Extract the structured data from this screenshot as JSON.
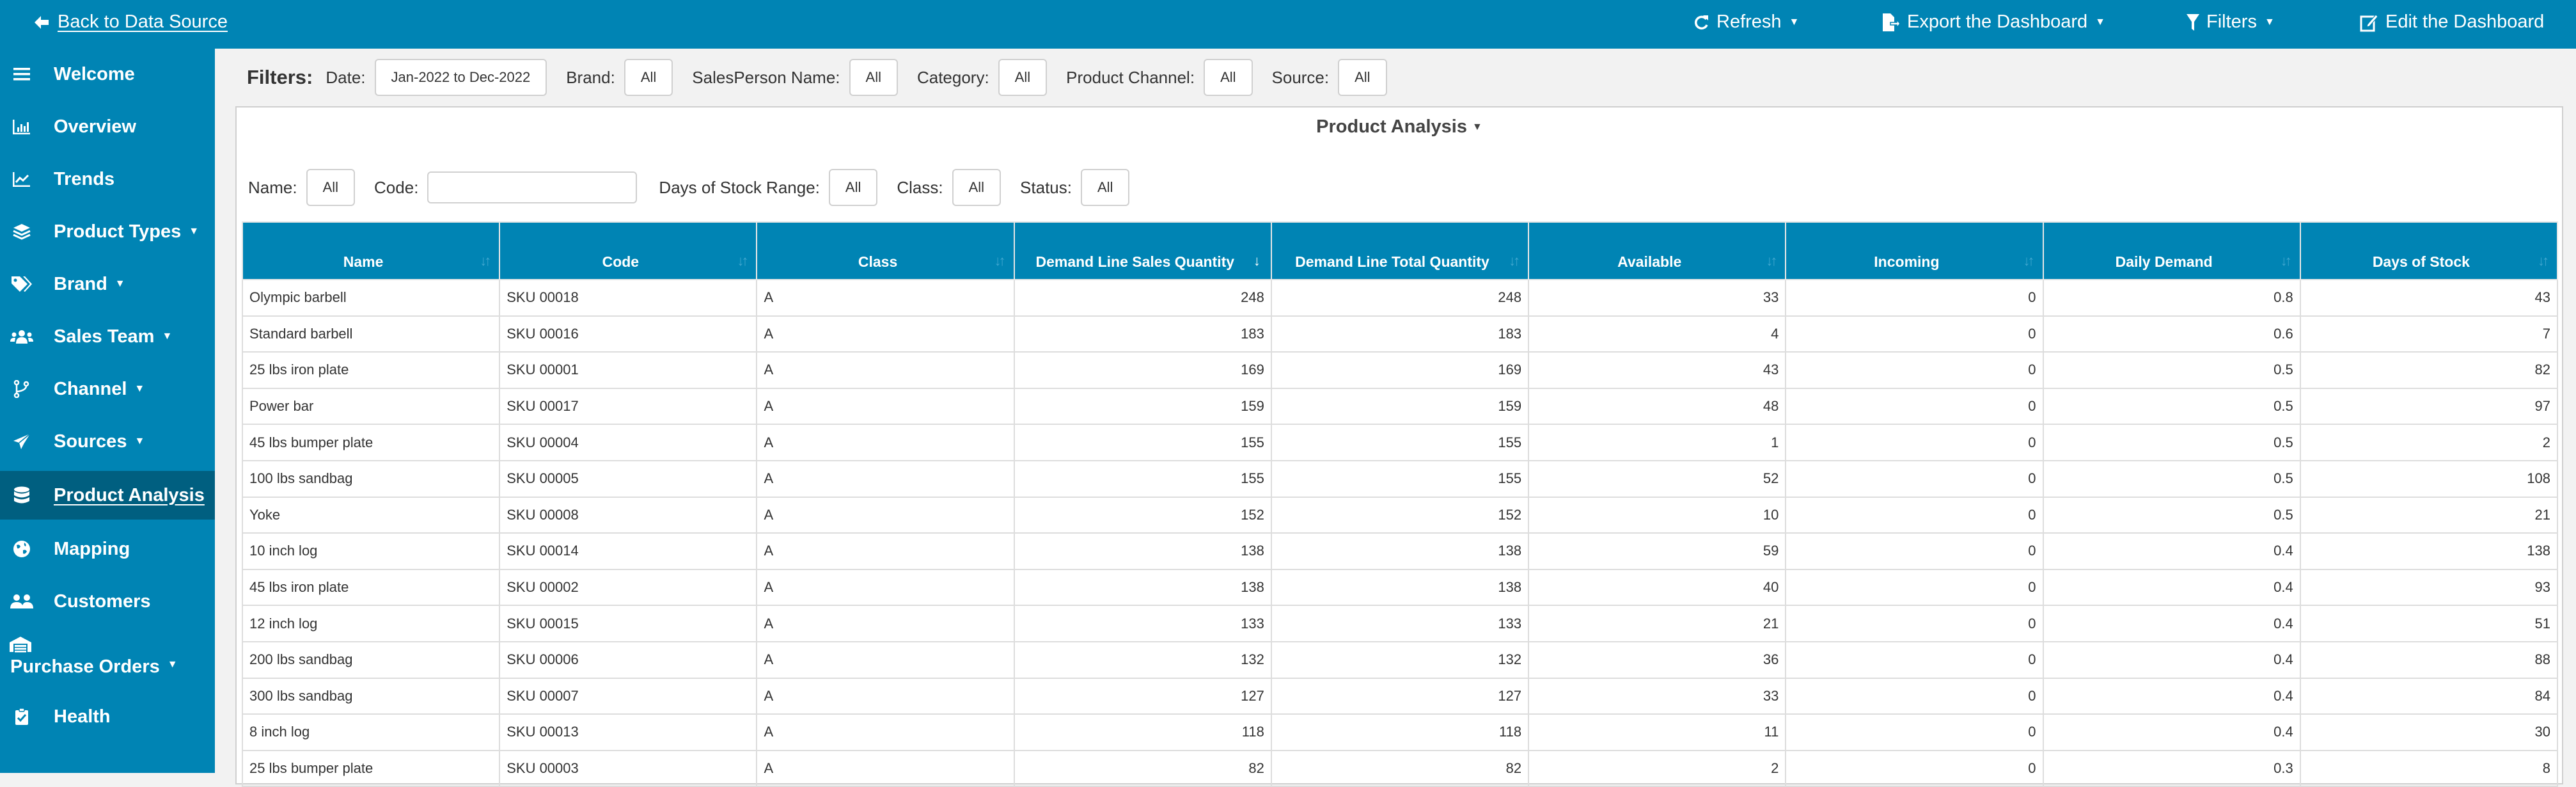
{
  "topbar": {
    "back_label": "Back to Data Source",
    "actions": [
      {
        "label": "Refresh",
        "icon": "refresh-icon",
        "has_caret": true
      },
      {
        "label": "Export the Dashboard",
        "icon": "export-file-icon",
        "has_caret": true
      },
      {
        "label": "Filters",
        "icon": "filter-icon",
        "has_caret": true
      },
      {
        "label": "Edit the Dashboard",
        "icon": "edit-icon",
        "has_caret": false
      }
    ]
  },
  "sidebar": {
    "items": [
      {
        "label": "Welcome",
        "icon": "menu-icon",
        "has_caret": false
      },
      {
        "label": "Overview",
        "icon": "bar-chart-icon",
        "has_caret": false
      },
      {
        "label": "Trends",
        "icon": "line-chart-icon",
        "has_caret": false
      },
      {
        "label": "Product Types",
        "icon": "layers-icon",
        "has_caret": true
      },
      {
        "label": "Brand",
        "icon": "tags-icon",
        "has_caret": true
      },
      {
        "label": "Sales Team",
        "icon": "users-icon",
        "has_caret": true
      },
      {
        "label": "Channel",
        "icon": "branch-icon",
        "has_caret": true
      },
      {
        "label": "Sources",
        "icon": "paper-plane-icon",
        "has_caret": true
      },
      {
        "label": "Product Analysis",
        "icon": "database-icon",
        "has_caret": false,
        "active": true
      },
      {
        "label": "Mapping",
        "icon": "globe-icon",
        "has_caret": false
      },
      {
        "label": "Customers",
        "icon": "user-group-icon",
        "has_caret": false
      },
      {
        "label": "Purchase Orders",
        "icon": "warehouse-icon",
        "has_caret": true
      },
      {
        "label": "Health",
        "icon": "clipboard-check-icon",
        "has_caret": false
      }
    ]
  },
  "filters": {
    "title": "Filters:",
    "items": [
      {
        "label": "Date:",
        "value": "Jan-2022 to Dec-2022"
      },
      {
        "label": "Brand:",
        "value": "All"
      },
      {
        "label": "SalesPerson Name:",
        "value": "All"
      },
      {
        "label": "Category:",
        "value": "All"
      },
      {
        "label": "Product Channel:",
        "value": "All"
      },
      {
        "label": "Source:",
        "value": "All"
      }
    ]
  },
  "panel": {
    "title": "Product Analysis",
    "subfilters": {
      "name_label": "Name:",
      "name_value": "All",
      "code_label": "Code:",
      "code_value": "",
      "code_placeholder": "",
      "dos_label": "Days of Stock Range:",
      "dos_value": "All",
      "class_label": "Class:",
      "class_value": "All",
      "status_label": "Status:",
      "status_value": "All"
    },
    "table": {
      "sorted_column": 3,
      "sort_direction": "desc",
      "columns": [
        "Name",
        "Code",
        "Class",
        "Demand Line Sales Quantity",
        "Demand Line Total Quantity",
        "Available",
        "Incoming",
        "Daily Demand",
        "Days of Stock"
      ],
      "rows": [
        [
          "Olympic barbell",
          "SKU 00018",
          "A",
          "248",
          "248",
          "33",
          "0",
          "0.8",
          "43"
        ],
        [
          "Standard barbell",
          "SKU 00016",
          "A",
          "183",
          "183",
          "4",
          "0",
          "0.6",
          "7"
        ],
        [
          "25 lbs iron plate",
          "SKU 00001",
          "A",
          "169",
          "169",
          "43",
          "0",
          "0.5",
          "82"
        ],
        [
          "Power bar",
          "SKU 00017",
          "A",
          "159",
          "159",
          "48",
          "0",
          "0.5",
          "97"
        ],
        [
          "45 lbs bumper plate",
          "SKU 00004",
          "A",
          "155",
          "155",
          "1",
          "0",
          "0.5",
          "2"
        ],
        [
          "100 lbs sandbag",
          "SKU 00005",
          "A",
          "155",
          "155",
          "52",
          "0",
          "0.5",
          "108"
        ],
        [
          "Yoke",
          "SKU 00008",
          "A",
          "152",
          "152",
          "10",
          "0",
          "0.5",
          "21"
        ],
        [
          "10 inch log",
          "SKU 00014",
          "A",
          "138",
          "138",
          "59",
          "0",
          "0.4",
          "138"
        ],
        [
          "45 lbs iron plate",
          "SKU 00002",
          "A",
          "138",
          "138",
          "40",
          "0",
          "0.4",
          "93"
        ],
        [
          "12 inch log",
          "SKU 00015",
          "A",
          "133",
          "133",
          "21",
          "0",
          "0.4",
          "51"
        ],
        [
          "200 lbs sandbag",
          "SKU 00006",
          "A",
          "132",
          "132",
          "36",
          "0",
          "0.4",
          "88"
        ],
        [
          "300 lbs sandbag",
          "SKU 00007",
          "A",
          "127",
          "127",
          "33",
          "0",
          "0.4",
          "84"
        ],
        [
          "8 inch log",
          "SKU 00013",
          "A",
          "118",
          "118",
          "11",
          "0",
          "0.4",
          "30"
        ],
        [
          "25 lbs bumper plate",
          "SKU 00003",
          "A",
          "82",
          "82",
          "2",
          "0",
          "0.3",
          "8"
        ]
      ]
    }
  },
  "colors": {
    "brand": "#0084b4",
    "sidebar_active": "#005f80",
    "background": "#f2f2f2"
  }
}
